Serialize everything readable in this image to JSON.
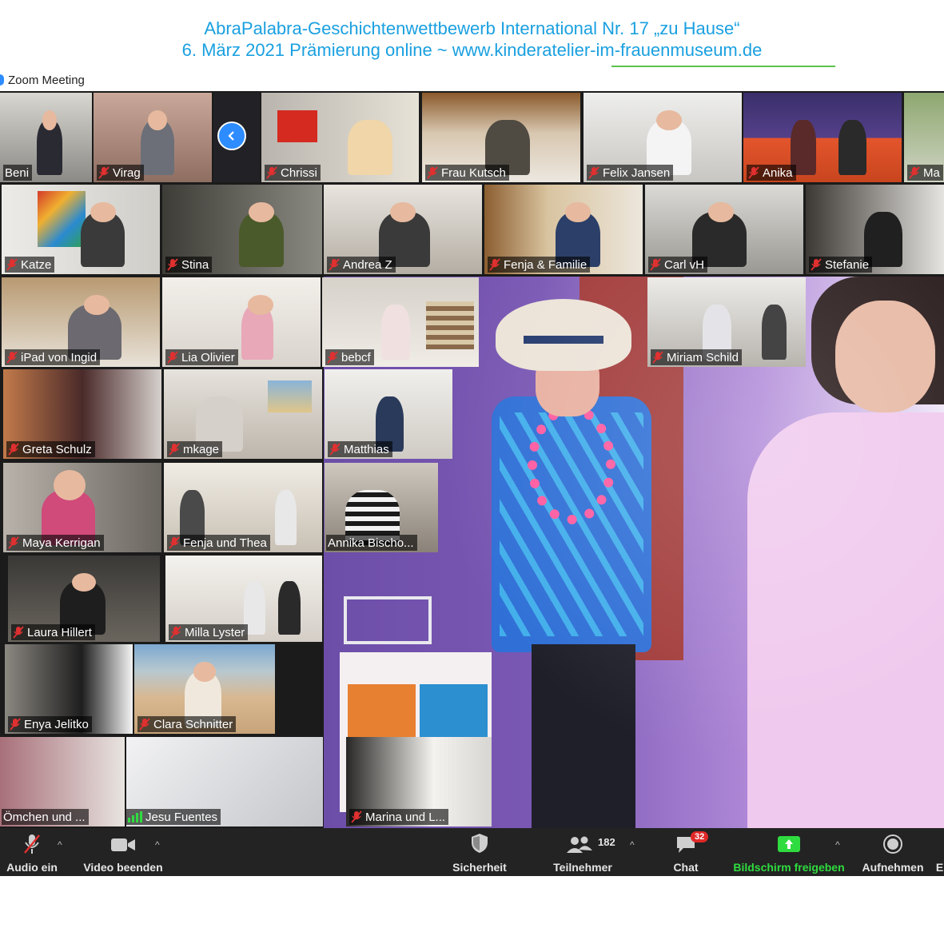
{
  "banner": {
    "line1": "AbraPalabra-Geschichtenwettbewerb International Nr. 17 „zu Hause“",
    "line2": "6. März 2021 Prämierung online ~ www.kinderatelier-im-frauenmuseum.de",
    "color": "#1aa0e0"
  },
  "window": {
    "title": "Zoom Meeting"
  },
  "participants": {
    "beni": "Beni",
    "virag": "Virag",
    "chrissi": "Chrissi",
    "frau_kutsch": "Frau Kutsch",
    "felix_jansen": "Felix Jansen",
    "anika": "Anika",
    "ma": "Ma",
    "katze": "Katze",
    "stina": "Stina",
    "andrea_z": "Andrea Z",
    "fenja_familie": "Fenja & Familie",
    "carl_vh": "Carl vH",
    "stefanie": "Stefanie",
    "ipad_ingid": "iPad von Ingid",
    "lia_olivier": "Lia Olivier",
    "bebcf": "bebcf",
    "miriam_schild": "Miriam Schild",
    "greta_schulz": "Greta Schulz",
    "mkage": "mkage",
    "matthias": "Matthias",
    "maya_kerrigan": "Maya Kerrigan",
    "fenja_thea": "Fenja und Thea",
    "annika_bischo": "Annika Bischo...",
    "laura_hillert": "Laura Hillert",
    "milla_lyster": "Milla Lyster",
    "enya_jelitko": "Enya Jelitko",
    "clara_schnitter": "Clara Schnitter",
    "omchen": "Ömchen und ...",
    "jesu_fuentes": "Jesu Fuentes",
    "marina": "Marina und L..."
  },
  "toolbar": {
    "audio": "Audio ein",
    "video": "Video beenden",
    "security": "Sicherheit",
    "participants": "Teilnehmer",
    "participants_count": "182",
    "chat": "Chat",
    "chat_badge": "32",
    "share": "Bildschirm freigeben",
    "record": "Aufnehmen",
    "more": "E",
    "share_color": "#2fdc3f",
    "badge_color": "#e02828"
  },
  "icons": {
    "mic_off": "mic-off-icon",
    "video": "video-camera-icon",
    "security": "shield-icon",
    "participants": "people-icon",
    "chat": "chat-bubble-icon",
    "share": "share-screen-icon",
    "record": "record-icon",
    "nav": "chevron-left-icon",
    "speaking": "audio-level-icon"
  }
}
